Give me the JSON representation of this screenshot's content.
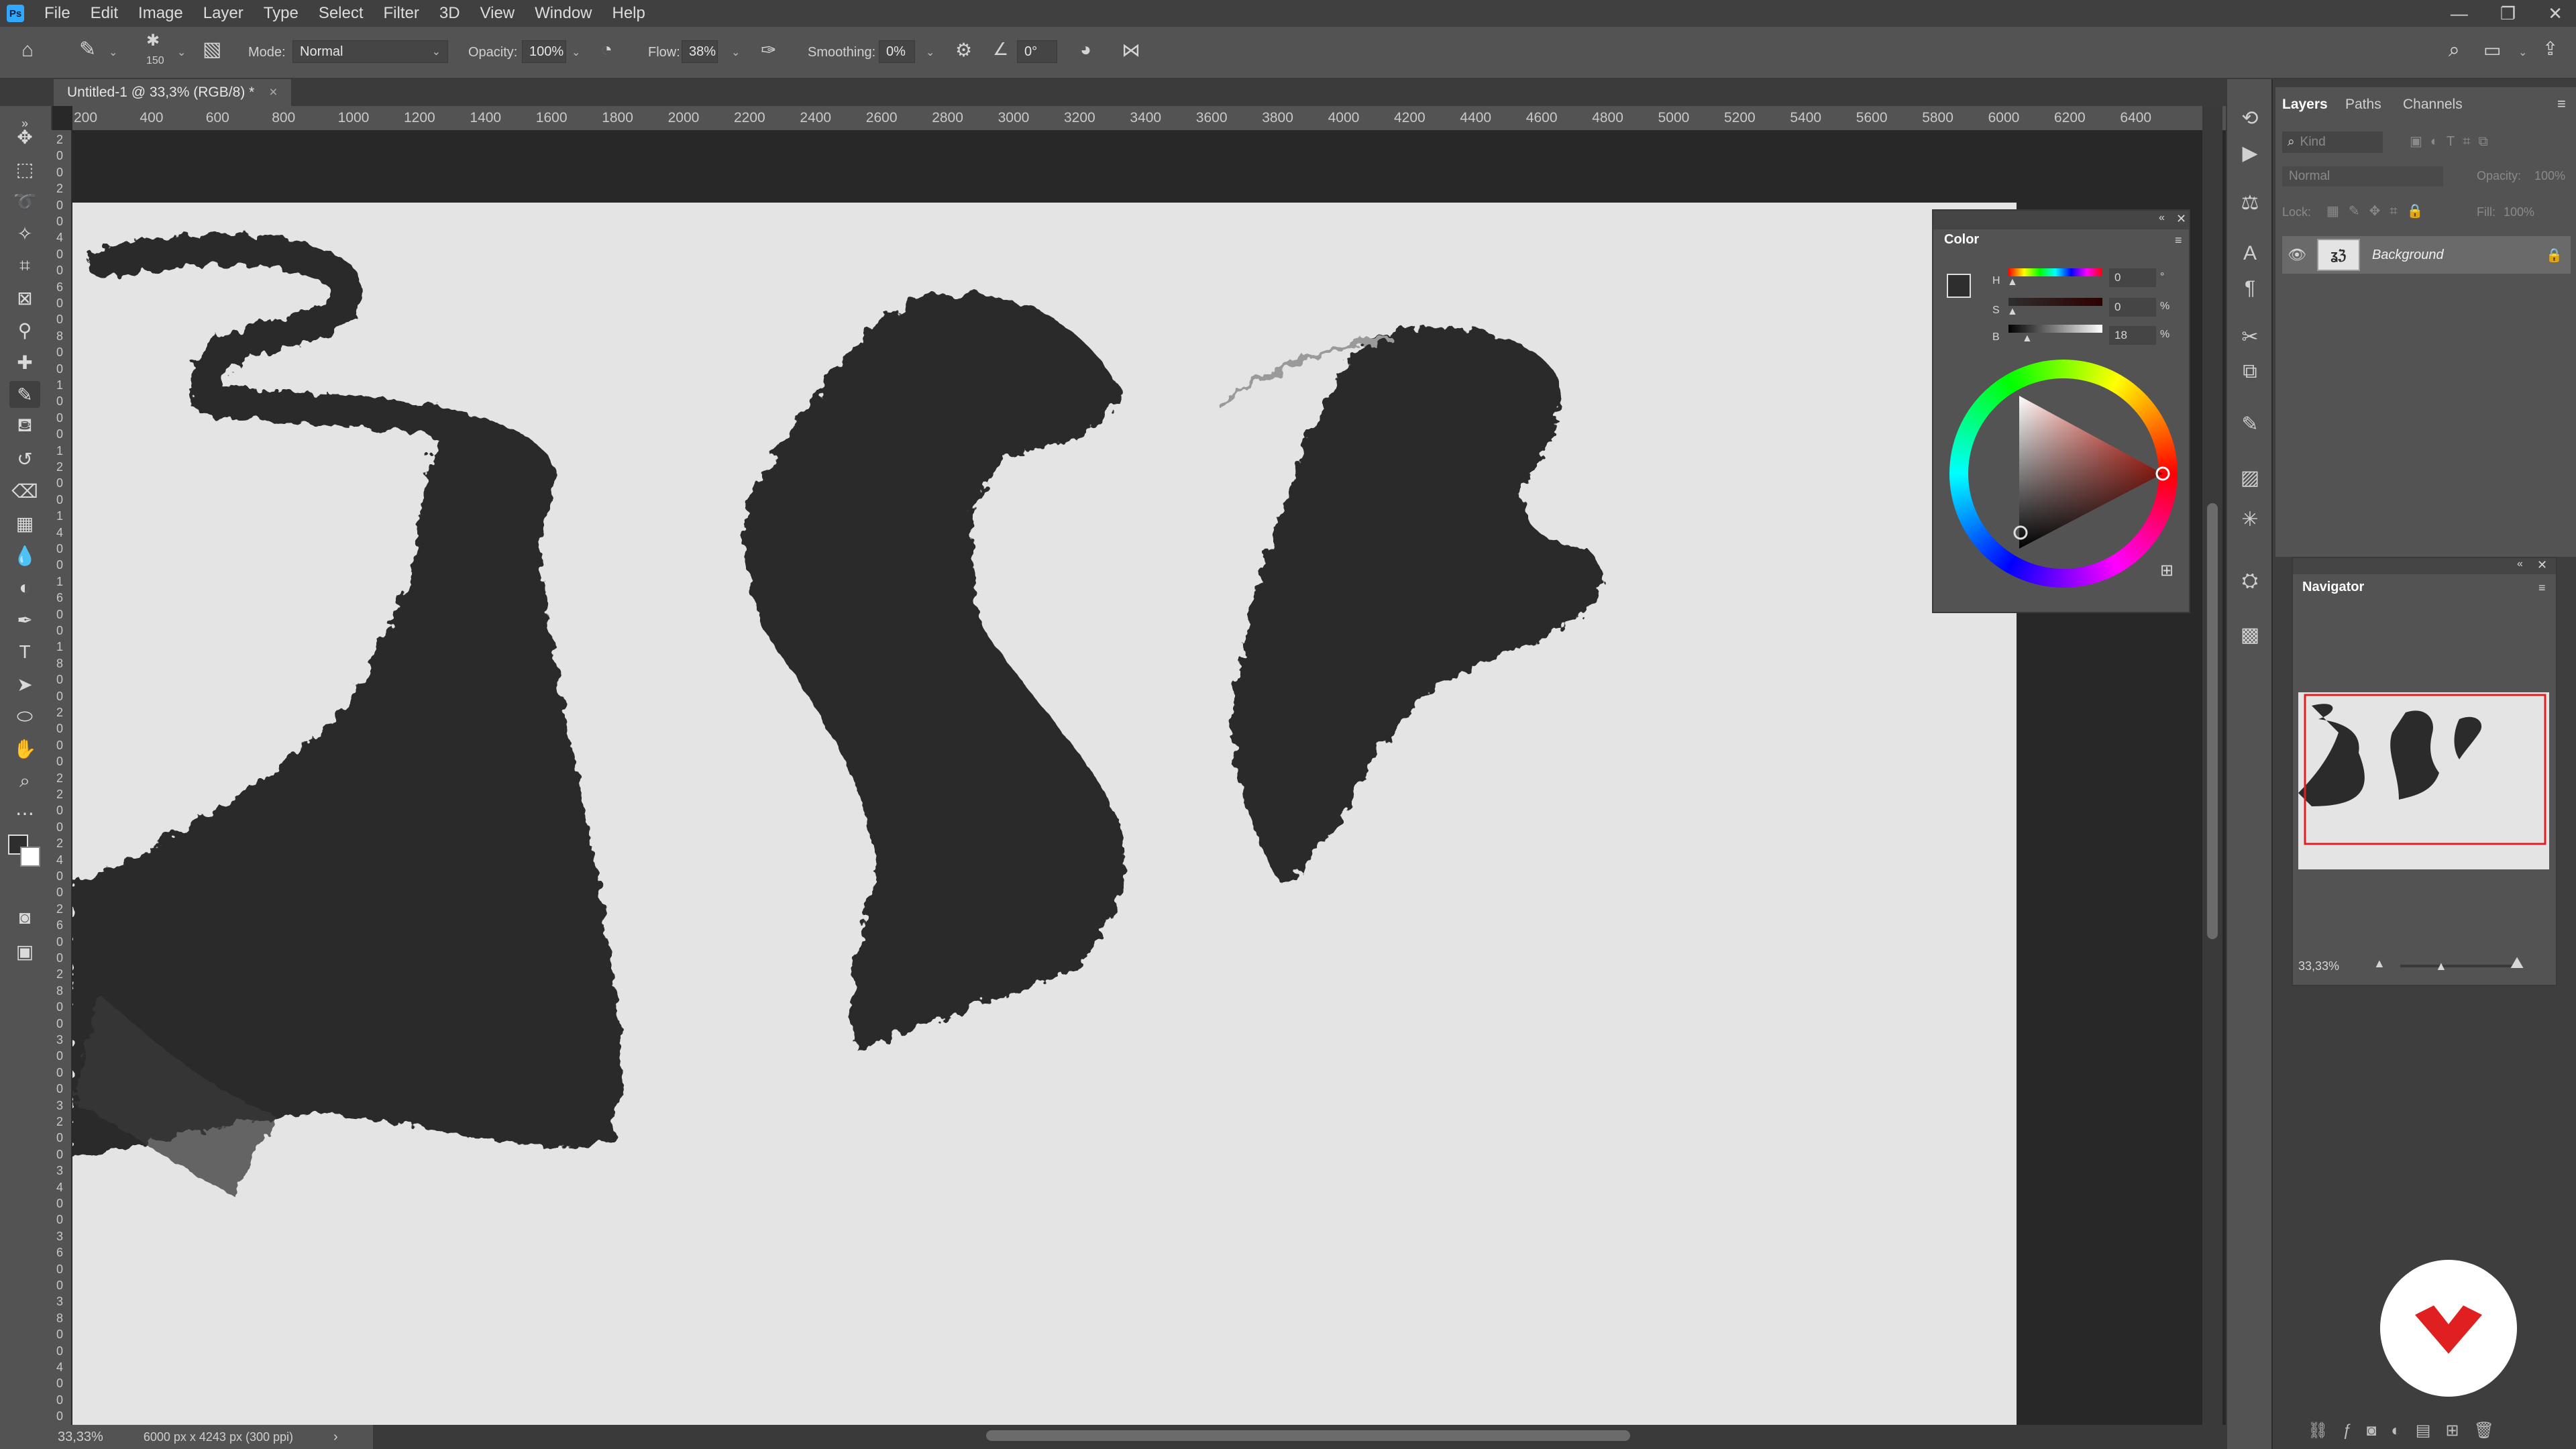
{
  "app": {
    "logo": "Ps"
  },
  "menu": [
    "File",
    "Edit",
    "Image",
    "Layer",
    "Type",
    "Select",
    "Filter",
    "3D",
    "View",
    "Window",
    "Help"
  ],
  "window_controls": {
    "minimize": "—",
    "restore": "❐",
    "close": "✕"
  },
  "options_bar": {
    "brush_size": "150",
    "mode_label": "Mode:",
    "mode_value": "Normal",
    "opacity_label": "Opacity:",
    "opacity_value": "100%",
    "flow_label": "Flow:",
    "flow_value": "38%",
    "smoothing_label": "Smoothing:",
    "smoothing_value": "0%",
    "angle_value": "0°"
  },
  "document": {
    "tab_title": "Untitled-1 @ 33,3% (RGB/8) *",
    "close": "×"
  },
  "ruler": {
    "horizontal": [
      "200",
      "400",
      "600",
      "800",
      "1000",
      "1200",
      "1400",
      "1600",
      "1800",
      "2000",
      "2200",
      "2400",
      "2600",
      "2800",
      "3000",
      "3200",
      "3400",
      "3600",
      "3800",
      "4000",
      "4200",
      "4400",
      "4600",
      "4800",
      "5000",
      "5200",
      "5400",
      "5600",
      "5800",
      "6000",
      "6200",
      "6400"
    ],
    "vertical": [
      "2",
      "0",
      "0",
      "2",
      "0",
      "0",
      "4",
      "0",
      "0",
      "6",
      "0",
      "0",
      "8",
      "0",
      "0",
      "1",
      "0",
      "0",
      "0",
      "1",
      "2",
      "0",
      "0",
      "1",
      "4",
      "0",
      "0",
      "1",
      "6",
      "0",
      "0",
      "1",
      "8",
      "0",
      "0",
      "2",
      "0",
      "0",
      "0",
      "2",
      "2",
      "0",
      "0",
      "2",
      "4",
      "0",
      "0",
      "2",
      "6",
      "0",
      "0",
      "2",
      "8",
      "0",
      "0",
      "3",
      "0",
      "0",
      "0",
      "3",
      "2",
      "0",
      "0",
      "3",
      "4",
      "0",
      "0",
      "3",
      "6",
      "0",
      "0",
      "3",
      "8",
      "0",
      "0",
      "4",
      "0",
      "0",
      "0",
      "4"
    ]
  },
  "status": {
    "zoom": "33,33%",
    "doc_info": "6000 px x 4243 px (300 ppi)",
    "arrow": "›"
  },
  "layers_panel": {
    "tabs": [
      "Layers",
      "Paths",
      "Channels"
    ],
    "filter_placeholder": "Kind",
    "blend_mode": "Normal",
    "opacity_label": "Opacity:",
    "opacity_value": "100%",
    "lock_label": "Lock:",
    "fill_label": "Fill:",
    "fill_value": "100%",
    "layer_name": "Background"
  },
  "color_panel": {
    "title": "Color",
    "h_label": "H",
    "h_value": "0",
    "h_unit": "°",
    "s_label": "S",
    "s_value": "0",
    "s_unit": "%",
    "b_label": "B",
    "b_value": "18",
    "b_unit": "%",
    "foreground": "#2e2e2e",
    "background": "#ffffff"
  },
  "navigator_panel": {
    "title": "Navigator",
    "zoom": "33,33%"
  },
  "colors": {
    "ps_blue": "#31a8ff",
    "accent_red": "#e02020",
    "paint": "#2b2b2b"
  }
}
